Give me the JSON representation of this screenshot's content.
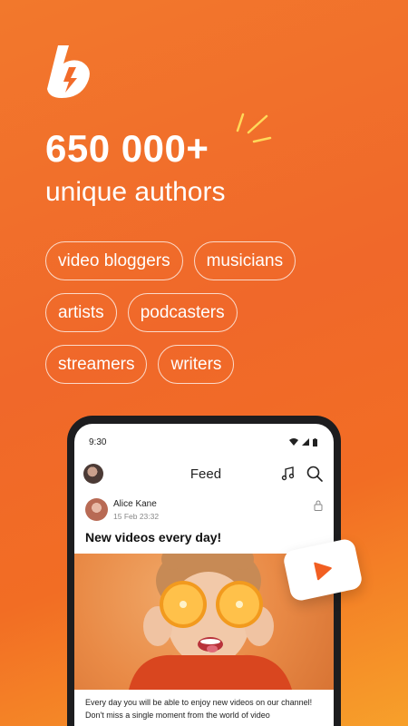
{
  "hero": {
    "headline": "650 000+",
    "subline": "unique authors"
  },
  "categories": [
    [
      "video bloggers",
      "musicians"
    ],
    [
      "artists",
      "podcasters"
    ],
    [
      "streamers",
      "writers"
    ]
  ],
  "phone": {
    "status_time": "9:30",
    "appbar_title": "Feed",
    "post": {
      "author": "Alice Kane",
      "date": "15 Feb 23:32",
      "title": "New videos every day!",
      "body": "Every day you will be able to enjoy new videos on our channel! Don't miss a single moment from the world of video"
    }
  },
  "icons": {
    "logo": "boosty-logo-icon",
    "music": "music-note-icon",
    "search": "search-icon",
    "lock": "lock-icon",
    "play": "play-icon"
  },
  "colors": {
    "brand_orange": "#f26b2a",
    "accent": "#f15f22",
    "spark": "#ffd95a"
  }
}
